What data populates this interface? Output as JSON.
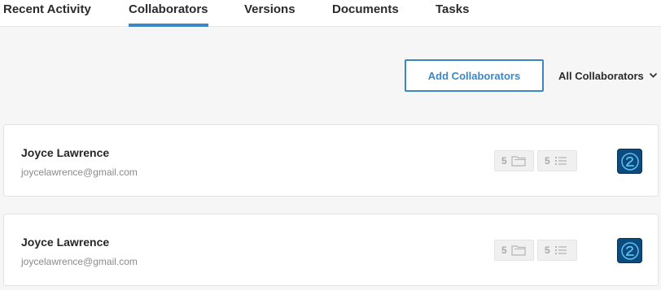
{
  "tabs": [
    {
      "label": "Recent Activity",
      "active": false
    },
    {
      "label": "Collaborators",
      "active": true
    },
    {
      "label": "Versions",
      "active": false
    },
    {
      "label": "Documents",
      "active": false
    },
    {
      "label": "Tasks",
      "active": false
    }
  ],
  "toolbar": {
    "add_button_label": "Add Collaborators",
    "filter_label": "All Collaborators"
  },
  "collaborators": [
    {
      "name": "Joyce Lawrence",
      "email": "joycelawrence@gmail.com",
      "file_count": "5",
      "task_count": "5",
      "app_icon": "app-logo-icon"
    },
    {
      "name": "Joyce Lawrence",
      "email": "joycelawrence@gmail.com",
      "file_count": "5",
      "task_count": "5",
      "app_icon": "app-logo-icon"
    }
  ],
  "colors": {
    "accent": "#3a87c8",
    "app_icon_bg": "#0d4a7e",
    "badge_text": "#a9a9a9"
  }
}
